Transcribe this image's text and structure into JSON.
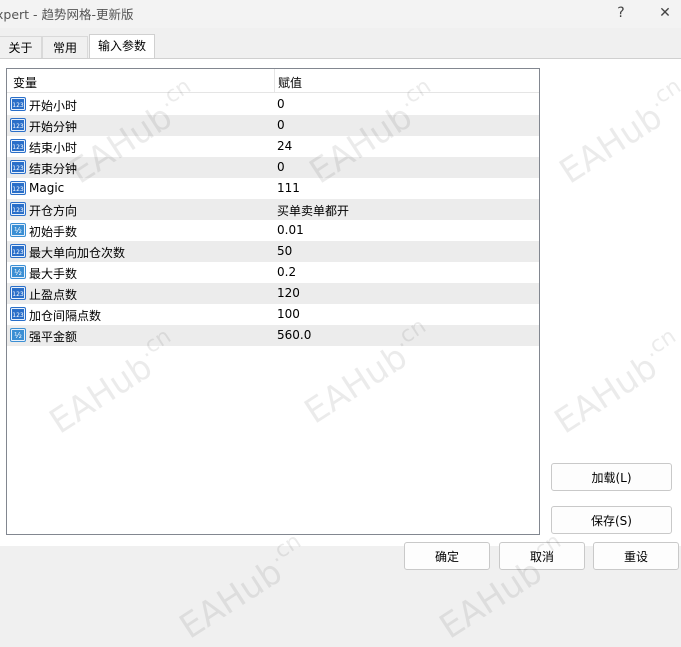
{
  "window": {
    "title": "xpert - 趋势网格-更新版",
    "help_label": "?",
    "close_label": "✕"
  },
  "tabs": [
    {
      "label": "关于",
      "active": false
    },
    {
      "label": "常用",
      "active": false
    },
    {
      "label": "输入参数",
      "active": true
    }
  ],
  "grid": {
    "columns": [
      "变量",
      "赋值"
    ],
    "rows": [
      {
        "name": "开始小时",
        "value": "0",
        "icon": "int-icon"
      },
      {
        "name": "开始分钟",
        "value": "0",
        "icon": "int-icon"
      },
      {
        "name": "结束小时",
        "value": "24",
        "icon": "int-icon"
      },
      {
        "name": "结束分钟",
        "value": "0",
        "icon": "int-icon"
      },
      {
        "name": "Magic",
        "value": "111",
        "icon": "int-icon"
      },
      {
        "name": "开仓方向",
        "value": "买单卖单都开",
        "icon": "int-icon"
      },
      {
        "name": "初始手数",
        "value": "0.01",
        "icon": "double-icon"
      },
      {
        "name": "最大单向加仓次数",
        "value": "50",
        "icon": "int-icon"
      },
      {
        "name": "最大手数",
        "value": "0.2",
        "icon": "double-icon"
      },
      {
        "name": "止盈点数",
        "value": "120",
        "icon": "int-icon"
      },
      {
        "name": "加仓间隔点数",
        "value": "100",
        "icon": "int-icon"
      },
      {
        "name": "强平金额",
        "value": "560.0",
        "icon": "double-icon"
      }
    ]
  },
  "side_buttons": {
    "load": "加载(L)",
    "save": "保存(S)"
  },
  "bottom_buttons": {
    "ok": "确定",
    "cancel": "取消",
    "reset": "重设"
  },
  "watermark": {
    "text": "EAHub",
    "suffix": ".cn"
  },
  "colors": {
    "alt_row": "#ececec",
    "int_icon": "#2a6fc9",
    "double_icon": "#3b8fd4"
  }
}
